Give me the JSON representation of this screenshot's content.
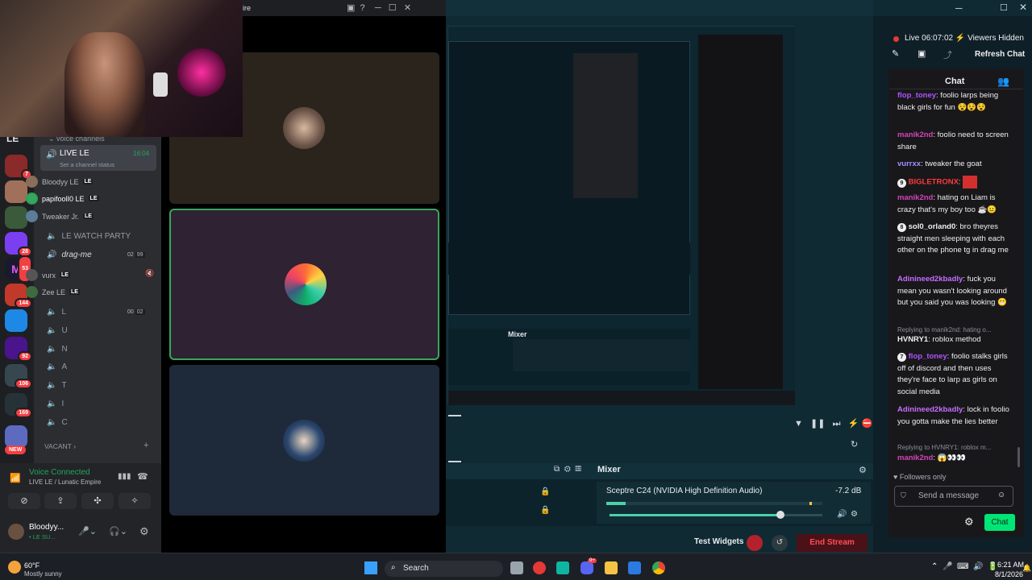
{
  "discord": {
    "title": "ire",
    "voice_channels_label": "voice channels",
    "active_channel": {
      "name": "LIVE LE",
      "timer": "16:04",
      "status_hint": "Set a channel status"
    },
    "members": [
      {
        "name": "Bloodyy LE",
        "tag": "LE"
      },
      {
        "name": "papifoolI0 LE",
        "tag": "LE"
      },
      {
        "name": "Tweaker Jr.",
        "tag": "LE"
      }
    ],
    "watch_party": "LE WATCH PARTY",
    "drag_me": {
      "name": "drag-me",
      "count_a": "02",
      "count_b": "99"
    },
    "drag_members": [
      {
        "name": "vurx",
        "tag": "LE"
      },
      {
        "name": "Zee LE",
        "tag": "LE"
      }
    ],
    "other_channels": [
      {
        "name": "L",
        "count_a": "00",
        "count_b": "02"
      },
      {
        "name": "U"
      },
      {
        "name": "N"
      },
      {
        "name": "A"
      },
      {
        "name": "T"
      },
      {
        "name": "I"
      },
      {
        "name": "C"
      }
    ],
    "category_vacant": "VACANT",
    "voice_status": "Voice Connected",
    "voice_location": "LIVE LE / Lunatic Empire",
    "user_name": "Bloodyy...",
    "user_status": "• LE SU...",
    "server_badges": [
      "7",
      "28",
      "53",
      "144",
      "92",
      "106",
      "169"
    ],
    "new_label": "NEW"
  },
  "obs": {
    "mixer_label": "Mixer",
    "device": "Sceptre C24 (NVIDIA High Definition Audio)",
    "db": "-7.2 dB",
    "test_widgets": "Test Widgets",
    "end_stream": "End Stream"
  },
  "chat": {
    "live_label": "Live",
    "live_time": "06:07:02",
    "viewers": "Viewers Hidden",
    "refresh": "Refresh Chat",
    "title": "Chat",
    "messages": [
      {
        "user": "flop_toney",
        "color": "#b052ff",
        "text": ": foolio larps being black girls for fun 😵😵😵"
      },
      {
        "user": "manik2nd",
        "color": "#d643b6",
        "text": ": foolio need to screen share"
      },
      {
        "user": "vurrxx",
        "color": "#a58bff",
        "text": ": tweaker the goat"
      },
      {
        "user": "BIGLETRONX",
        "color": "#ff3b3b",
        "text": ":"
      },
      {
        "user": "manik2nd",
        "color": "#d643b6",
        "text": ": hating on Liam is crazy that's my boy too ☕😐"
      },
      {
        "user": "sol0_orland0",
        "color": "#efeff1",
        "text": ": bro theyres straight men sleeping with each other on the phone tg in drag me"
      },
      {
        "user": "Adinineed2kbadly",
        "color": "#c86dff",
        "text": ": fuck you mean you wasn't looking around but you said you was looking 😬"
      },
      {
        "user": "HVNRY1",
        "color": "#efeff1",
        "text": ": roblox method"
      },
      {
        "user": "flop_toney",
        "color": "#b052ff",
        "text": ": foolio stalks girls off of discord and then uses they're face to larp as girls on social media"
      },
      {
        "user": "Adinineed2kbadly",
        "color": "#c86dff",
        "text": ": lock in foolio you gotta make the lies better"
      },
      {
        "user": "manik2nd",
        "color": "#d643b6",
        "text": ": 😱👀👀"
      }
    ],
    "reply_1": "Replying to manik2nd: hating o...",
    "reply_2": "Replying to HVNRY1: roblox m...",
    "followers_only": "Followers only",
    "send_placeholder": "Send a message",
    "chat_button": "Chat"
  },
  "taskbar": {
    "weather_temp": "60°F",
    "weather_desc": "Mostly sunny",
    "search": "Search",
    "time": "6:21 AM",
    "date": "8/1/2026",
    "discord_badge": "9+"
  }
}
